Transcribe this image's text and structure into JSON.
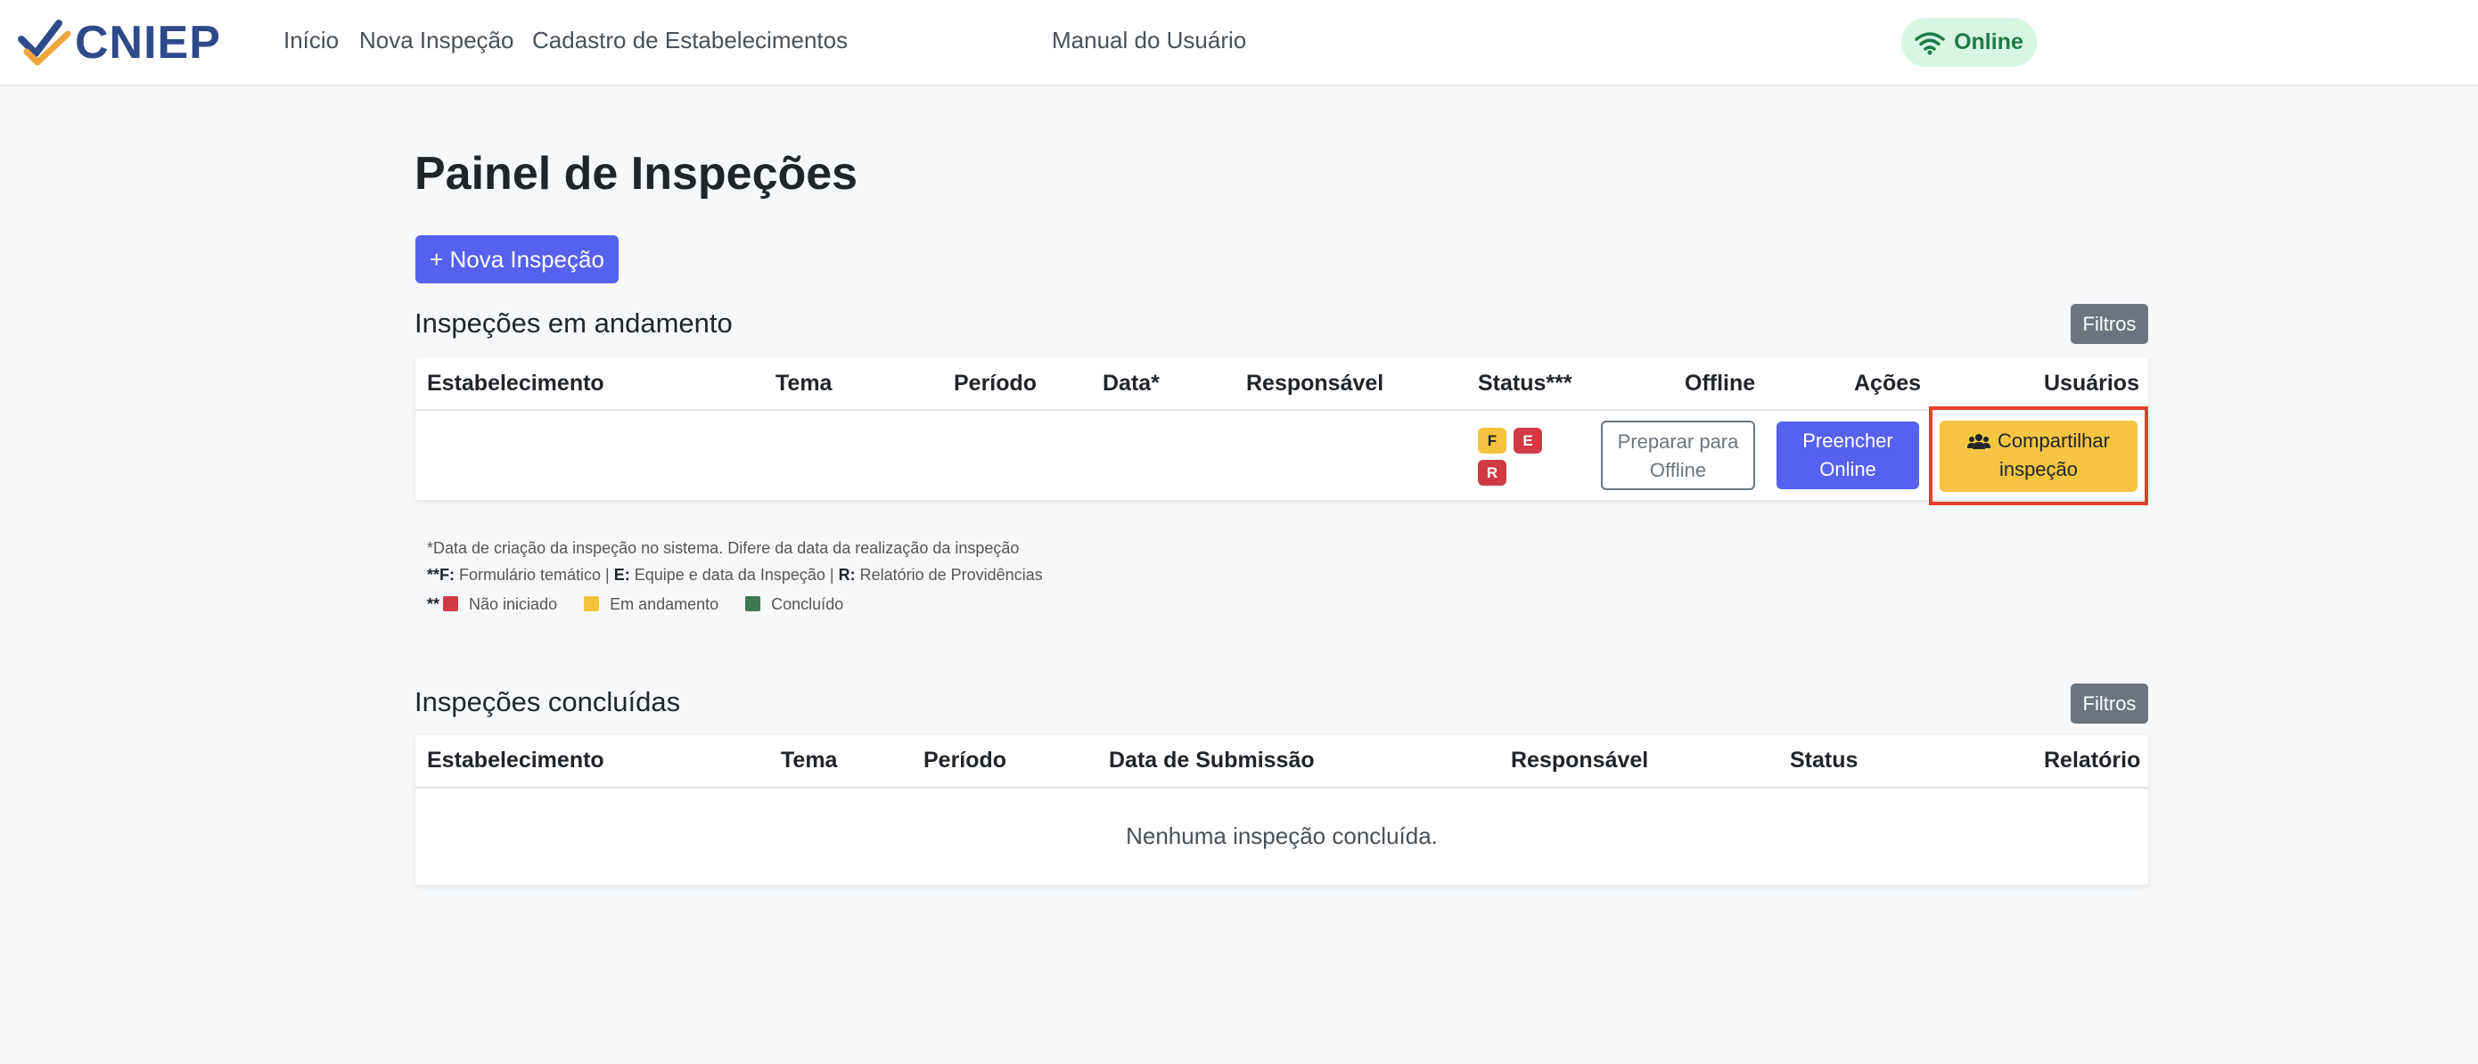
{
  "nav": {
    "brand": "CNIEP",
    "links": [
      "Início",
      "Nova Inspeção",
      "Cadastro de Estabelecimentos",
      "Manual do Usuário"
    ],
    "status": "Online"
  },
  "page": {
    "title": "Painel de Inspeções",
    "new_button": "+ Nova Inspeção"
  },
  "in_progress": {
    "title": "Inspeções em andamento",
    "filter": "Filtros",
    "columns": [
      "Estabelecimento",
      "Tema",
      "Período",
      "Data*",
      "Responsável",
      "Status***",
      "Offline",
      "Ações",
      "Usuários"
    ],
    "row": {
      "badges": [
        "F",
        "E",
        "R"
      ],
      "offline_line1": "Preparar para",
      "offline_line2": "Offline",
      "online_line1": "Preencher",
      "online_line2": "Online",
      "share_line1": "Compartilhar",
      "share_line2": "inspeção"
    }
  },
  "legend": {
    "line1": "*Data de criação da inspeção no sistema. Difere da data da realização da inspeção",
    "line2_prefix": "**F:",
    "line2_f": " Formulário temático | ",
    "line2_e_key": "E:",
    "line2_e": " Equipe e data da Inspeção | ",
    "line2_r_key": "R:",
    "line2_r": " Relatório de Providências",
    "line3_prefix": "**",
    "not_started": "Não iniciado",
    "in_progress": "Em andamento",
    "done": "Concluído",
    "colors": {
      "not_started": "#d13a45",
      "in_progress": "#f4c23d",
      "done": "#3d7a52"
    }
  },
  "completed": {
    "title": "Inspeções concluídas",
    "filter": "Filtros",
    "columns": [
      "Estabelecimento",
      "Tema",
      "Período",
      "Data de Submissão",
      "Responsável",
      "Status",
      "Relatório"
    ],
    "empty": "Nenhuma inspeção concluída."
  }
}
